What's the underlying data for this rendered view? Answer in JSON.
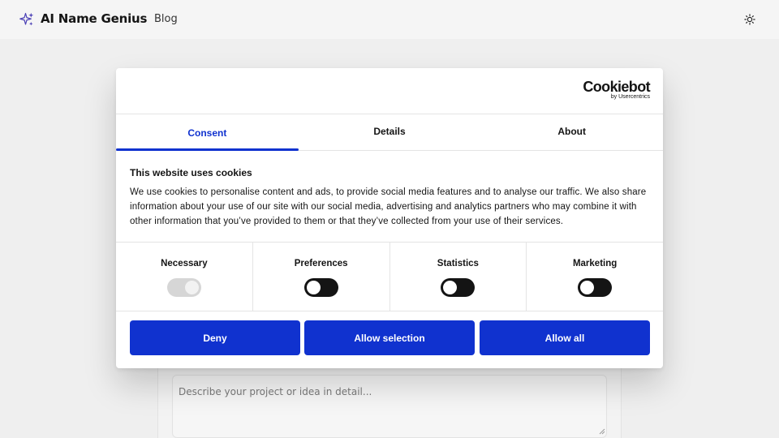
{
  "header": {
    "brand": "AI Name Genius",
    "nav_blog": "Blog",
    "logo_icon": "sparkle-icon",
    "theme_icon": "sun-icon"
  },
  "background": {
    "textarea_placeholder": "Describe your project or idea in detail..."
  },
  "cookie_dialog": {
    "logo_text": "Cookiebot",
    "logo_subtext": "by Usercentrics",
    "tabs": [
      {
        "label": "Consent",
        "active": true
      },
      {
        "label": "Details",
        "active": false
      },
      {
        "label": "About",
        "active": false
      }
    ],
    "title": "This website uses cookies",
    "body": "We use cookies to personalise content and ads, to provide social media features and to analyse our traffic. We also share information about your use of our site with our social media, advertising and analytics partners who may combine it with other information that you’ve provided to them or that they’ve collected from your use of their services.",
    "toggles": [
      {
        "label": "Necessary",
        "state": "on",
        "disabled": true
      },
      {
        "label": "Preferences",
        "state": "off",
        "disabled": false
      },
      {
        "label": "Statistics",
        "state": "off",
        "disabled": false
      },
      {
        "label": "Marketing",
        "state": "off",
        "disabled": false
      }
    ],
    "buttons": {
      "deny": "Deny",
      "allow_selection": "Allow selection",
      "allow_all": "Allow all"
    },
    "accent_color": "#1032cf"
  }
}
